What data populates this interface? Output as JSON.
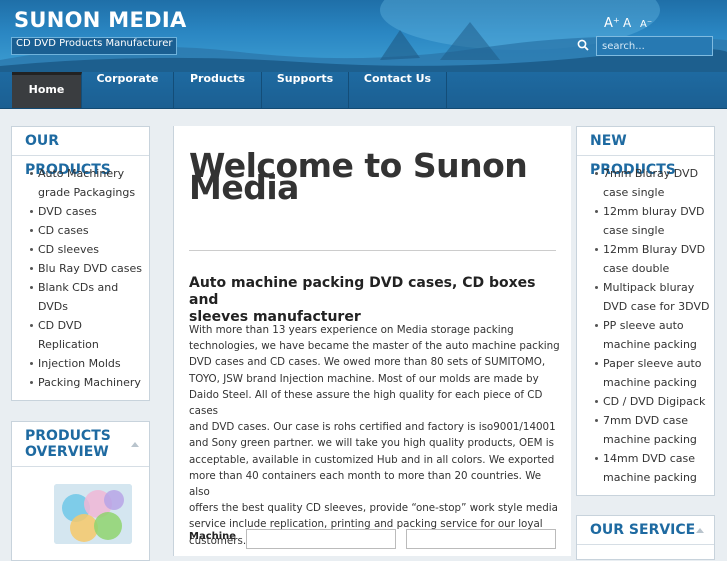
{
  "header": {
    "site_title": "SUNON MEDIA",
    "site_subtitle": "CD DVD Products Manufacturer",
    "font_controls": [
      "A⁺",
      "A",
      "A⁻"
    ],
    "search_placeholder": "search...",
    "colors": {
      "header_bg": "#2a86c2",
      "nav_bg": "#1e6aa1",
      "nav_active": "#3a3d40",
      "accent": "#1e6aa1"
    }
  },
  "nav": {
    "items": [
      {
        "label": "Home",
        "active": true
      },
      {
        "label": "Corporate"
      },
      {
        "label": "Products"
      },
      {
        "label": "Supports"
      },
      {
        "label": "Contact Us"
      }
    ]
  },
  "left": {
    "our_products_title": "OUR PRODUCTS",
    "products": [
      [
        "Auto Machinery",
        "grade Packagings"
      ],
      [
        "DVD cases"
      ],
      [
        "CD cases"
      ],
      [
        "CD sleeves"
      ],
      [
        "Blu Ray DVD cases"
      ],
      [
        "Blank CDs and",
        "DVDs"
      ],
      [
        "CD DVD",
        "Replication"
      ],
      [
        "Injection Molds"
      ],
      [
        "Packing Machinery"
      ]
    ],
    "overview_title_1": "PRODUCTS",
    "overview_title_2": "OVERVIEW"
  },
  "main": {
    "welcome_1": "Welcome to Sunon",
    "welcome_2": "Media",
    "headline_1": "Auto machine packing DVD cases, CD boxes and",
    "headline_2": "sleeves manufacturer",
    "body_lines": [
      "With more than 13 years experience on Media storage packing",
      "technologies, we have became the master of the auto machine packing",
      "DVD cases and CD cases. We owed more than 80 sets of SUMITOMO,",
      "TOYO, JSW brand Injection machine. Most of our molds are made by",
      "Daido Steel. All of these assure the high quality for each piece of CD cases",
      "and DVD cases. Our case is rohs certified and factory is iso9001/14001",
      "and Sony green partner. we will take you high quality products, OEM is",
      "acceptable, available in customized Hub and in all colors. We exported",
      "more than 40 containers each month to more than 20 countries. We also",
      "offers the best quality CD sleeves, provide “one-stop” work style media",
      "service include replication, printing and packing service for our loyal",
      "customers."
    ],
    "machine_label": "Machine"
  },
  "right": {
    "new_products_title": "NEW PRODUCTS",
    "new_products": [
      [
        "7mm Bluray DVD",
        "case single"
      ],
      [
        "12mm bluray DVD",
        "case single"
      ],
      [
        "12mm Bluray DVD",
        "case double"
      ],
      [
        "Multipack bluray",
        "DVD case for 3DVD"
      ],
      [
        "PP sleeve auto",
        "machine packing"
      ],
      [
        "Paper sleeve auto",
        "machine packing"
      ],
      [
        "CD / DVD Digipack"
      ],
      [
        "7mm DVD case",
        "machine packing"
      ],
      [
        "14mm DVD case",
        "machine packing"
      ]
    ],
    "our_service_title": "OUR SERVICE"
  }
}
